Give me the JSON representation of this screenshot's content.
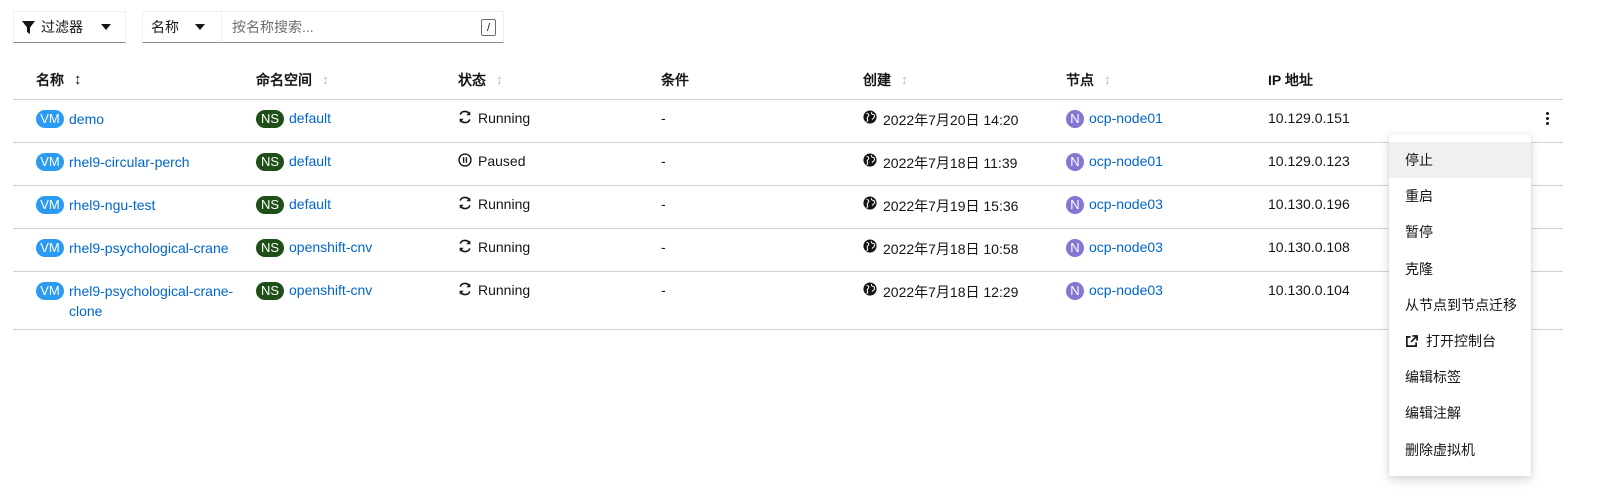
{
  "toolbar": {
    "filter_label": "过滤器",
    "name_select_label": "名称",
    "search_placeholder": "按名称搜索...",
    "search_shortcut": "/"
  },
  "columns": {
    "name": "名称",
    "namespace": "命名空间",
    "status": "状态",
    "conditions": "条件",
    "created": "创建",
    "node": "节点",
    "ip": "IP 地址"
  },
  "badges": {
    "vm": "VM",
    "ns": "NS",
    "node": "N"
  },
  "rows": [
    {
      "name": "demo",
      "namespace": "default",
      "status": "Running",
      "status_icon": "sync-icon",
      "conditions": "-",
      "created": "2022年7月20日 14:20",
      "node": "ocp-node01",
      "ip": "10.129.0.151"
    },
    {
      "name": "rhel9-circular-perch",
      "namespace": "default",
      "status": "Paused",
      "status_icon": "pause-circle-icon",
      "conditions": "-",
      "created": "2022年7月18日 11:39",
      "node": "ocp-node01",
      "ip": "10.129.0.123"
    },
    {
      "name": "rhel9-ngu-test",
      "namespace": "default",
      "status": "Running",
      "status_icon": "sync-icon",
      "conditions": "-",
      "created": "2022年7月19日 15:36",
      "node": "ocp-node03",
      "ip": "10.130.0.196"
    },
    {
      "name": "rhel9-psychological-crane",
      "namespace": "openshift-cnv",
      "status": "Running",
      "status_icon": "sync-icon",
      "conditions": "-",
      "created": "2022年7月18日 10:58",
      "node": "ocp-node03",
      "ip": "10.130.0.108"
    },
    {
      "name": "rhel9-psychological-crane-clone",
      "namespace": "openshift-cnv",
      "status": "Running",
      "status_icon": "sync-icon",
      "conditions": "-",
      "created": "2022年7月18日 12:29",
      "node": "ocp-node03",
      "ip": "10.130.0.104"
    }
  ],
  "actions_menu": {
    "items": [
      "停止",
      "重启",
      "暂停",
      "克隆",
      "从节点到节点迁移",
      "打开控制台",
      "编辑标签",
      "编辑注解",
      "删除虚拟机"
    ],
    "hovered": "停止",
    "external_link_item": "打开控制台"
  },
  "colors": {
    "link": "#0066cc",
    "vm_badge": "#2b9af3",
    "ns_badge": "#1e4f18",
    "node_badge": "#8476d1"
  }
}
